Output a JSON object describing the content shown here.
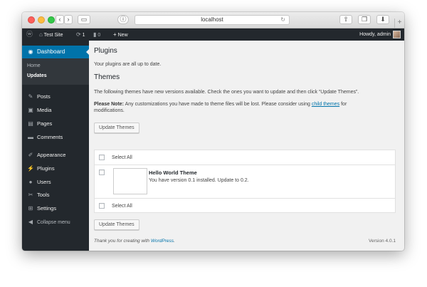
{
  "browser": {
    "url": "localhost",
    "reader_icon": "reader-icon",
    "share_icon": "share-icon",
    "tabs_icon": "tabs-overview-icon",
    "downloads_icon": "downloads-icon"
  },
  "adminbar": {
    "site_name": "Test Site",
    "updates_count": "1",
    "comments_count": "0",
    "new_label": "New",
    "greeting": "Howdy, admin"
  },
  "sidebar": {
    "dashboard_label": "Dashboard",
    "submenu": [
      "Home",
      "Updates"
    ],
    "items": [
      {
        "label": "Posts",
        "icon": "pin-icon"
      },
      {
        "label": "Media",
        "icon": "media-icon"
      },
      {
        "label": "Pages",
        "icon": "pages-icon"
      },
      {
        "label": "Comments",
        "icon": "comment-icon"
      },
      {
        "label": "Appearance",
        "icon": "brush-icon"
      },
      {
        "label": "Plugins",
        "icon": "plugin-icon"
      },
      {
        "label": "Users",
        "icon": "users-icon"
      },
      {
        "label": "Tools",
        "icon": "wrench-icon"
      },
      {
        "label": "Settings",
        "icon": "settings-icon"
      },
      {
        "label": "Collapse menu",
        "icon": "collapse-icon"
      }
    ]
  },
  "main": {
    "plugins_title": "Plugins",
    "plugins_text": "Your plugins are all up to date.",
    "themes_title": "Themes",
    "themes_text": "The following themes have new versions available. Check the ones you want to update and then click “Update Themes”.",
    "note_strong": "Please Note:",
    "note_text": "Any customizations you have made to theme files will be lost. Please consider using",
    "note_link": "child themes",
    "note_end": "for",
    "note_line2": "modifications.",
    "update_button": "Update Themes",
    "select_all": "Select All",
    "theme_name": "Hello World Theme",
    "theme_desc": "You have version 0.1 installed. Update to 0.2."
  },
  "footer": {
    "thanks": "Thank you for creating with",
    "wp_link": "WordPress",
    "version": "Version 4.0.1"
  },
  "colors": {
    "admin_dark": "#23282d",
    "accent_blue": "#0073aa",
    "background": "#f1f1f1"
  }
}
